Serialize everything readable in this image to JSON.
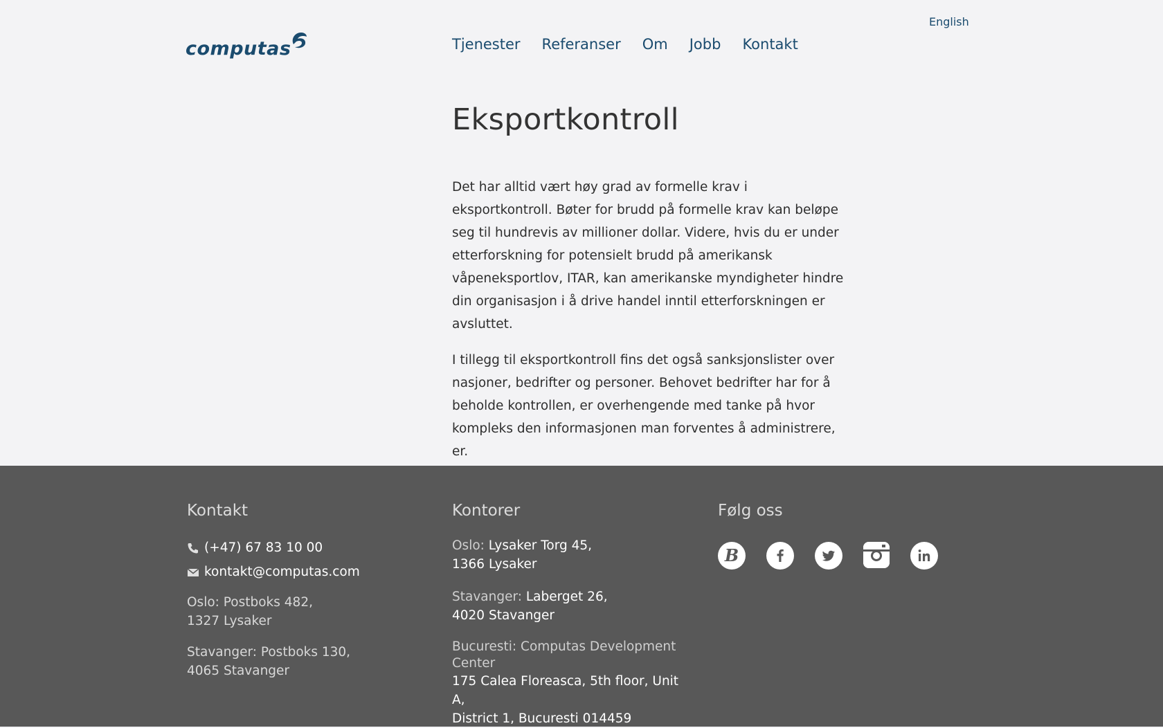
{
  "header": {
    "logo_text": "computas",
    "language_link": "English",
    "nav": [
      "Tjenester",
      "Referanser",
      "Om",
      "Jobb",
      "Kontakt"
    ]
  },
  "main": {
    "title": "Eksportkontroll",
    "paragraphs": [
      "Det har alltid vært høy grad av formelle krav i eksportkontroll. Bøter for brudd på formelle krav kan beløpe seg til hundrevis av millioner dollar. Videre, hvis du er under etterforskning for potensielt brudd på amerikansk våpeneksportlov, ITAR, kan amerikanske myndigheter hindre din organisasjon i å drive handel inntil etterforskningen er avsluttet.",
      "I tillegg til eksportkontroll fins det også sanksjonslister over nasjoner, bedrifter og personer. Behovet bedrifter har for å beholde kontrollen, er overhengende med tanke på hvor kompleks den informasjonen man forventes å administrere, er."
    ]
  },
  "footer": {
    "contact": {
      "heading": "Kontakt",
      "phone": "(+47) 67 83 10 00",
      "email": "kontakt@computas.com",
      "postal": [
        {
          "line1": "Oslo: Postboks 482,",
          "line2": "1327 Lysaker"
        },
        {
          "line1": "Stavanger: Postboks 130,",
          "line2": "4065 Stavanger"
        }
      ]
    },
    "offices": {
      "heading": "Kontorer",
      "list": [
        {
          "city": "Oslo:",
          "line1": "Lysaker Torg 45,",
          "line2": "1366 Lysaker"
        },
        {
          "city": "Stavanger:",
          "line1": "Laberget 26,",
          "line2": "4020 Stavanger"
        },
        {
          "city": "Bucuresti: Computas Development Center",
          "line1": "175 Calea Floreasca, 5th floor, Unit A,",
          "line2": "District 1, Bucuresti 014459"
        }
      ]
    },
    "social": {
      "heading": "Følg oss",
      "icons": [
        "blog-icon",
        "facebook-icon",
        "twitter-icon",
        "instagram-icon",
        "linkedin-icon"
      ]
    }
  },
  "colors": {
    "brand": "#1a4b6e",
    "background": "#f3f3f5",
    "footer": "#585858"
  }
}
